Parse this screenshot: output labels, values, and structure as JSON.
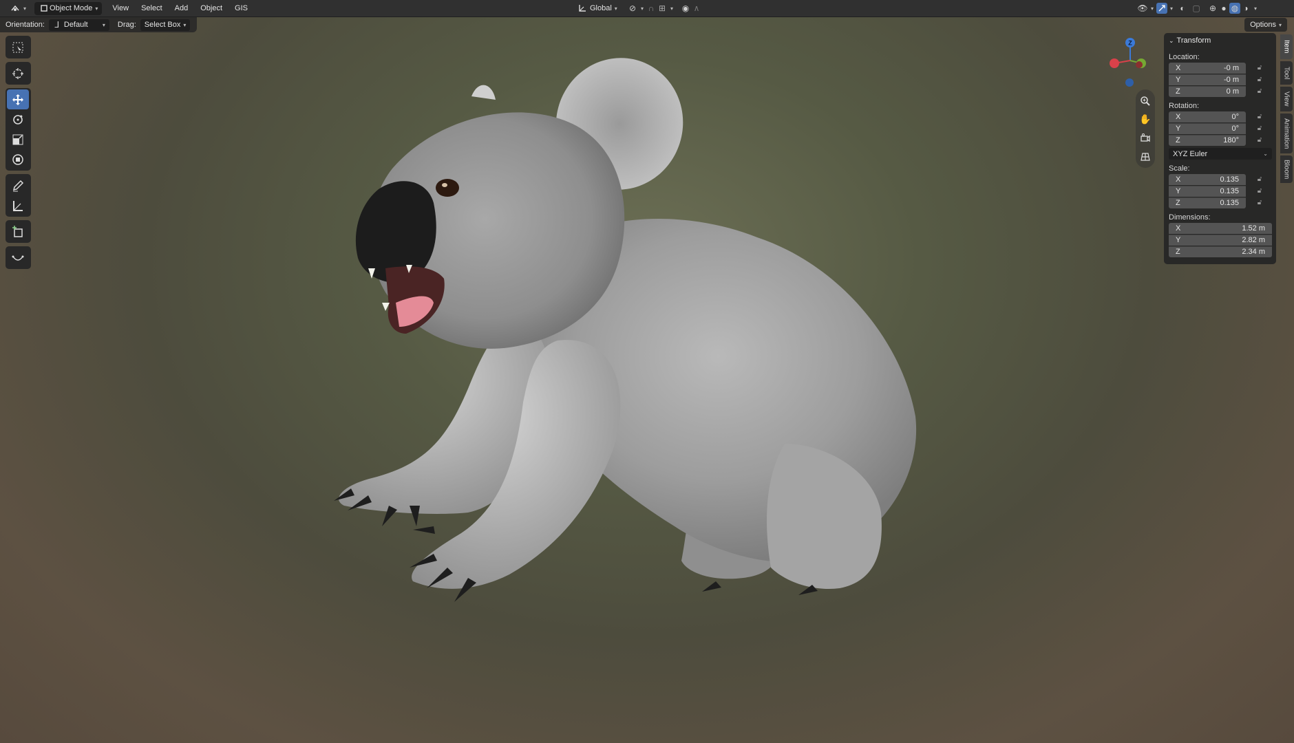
{
  "header": {
    "mode_label": "Object Mode",
    "menus": [
      "View",
      "Select",
      "Add",
      "Object",
      "GIS"
    ],
    "transform_orientation": "Global"
  },
  "tool_settings": {
    "orientation_label": "Orientation:",
    "orientation_value": "Default",
    "drag_label": "Drag:",
    "drag_value": "Select Box",
    "options_label": "Options"
  },
  "gizmo": {
    "z_label": "Z"
  },
  "side_tabs": [
    "Item",
    "Tool",
    "View",
    "Animation",
    "Bloom"
  ],
  "transform_panel": {
    "title": "Transform",
    "location_label": "Location:",
    "location": [
      {
        "axis": "X",
        "value": "-0 m"
      },
      {
        "axis": "Y",
        "value": "-0 m"
      },
      {
        "axis": "Z",
        "value": "0 m"
      }
    ],
    "rotation_label": "Rotation:",
    "rotation": [
      {
        "axis": "X",
        "value": "0°"
      },
      {
        "axis": "Y",
        "value": "0°"
      },
      {
        "axis": "Z",
        "value": "180°"
      }
    ],
    "rotation_mode": "XYZ Euler",
    "scale_label": "Scale:",
    "scale": [
      {
        "axis": "X",
        "value": "0.135"
      },
      {
        "axis": "Y",
        "value": "0.135"
      },
      {
        "axis": "Z",
        "value": "0.135"
      }
    ],
    "dimensions_label": "Dimensions:",
    "dimensions": [
      {
        "axis": "X",
        "value": "1.52 m"
      },
      {
        "axis": "Y",
        "value": "2.82 m"
      },
      {
        "axis": "Z",
        "value": "2.34 m"
      }
    ]
  },
  "colors": {
    "accent": "#4772b3",
    "axis_x": "#d9414a",
    "axis_y": "#76a833",
    "axis_z": "#3b7ad8"
  }
}
